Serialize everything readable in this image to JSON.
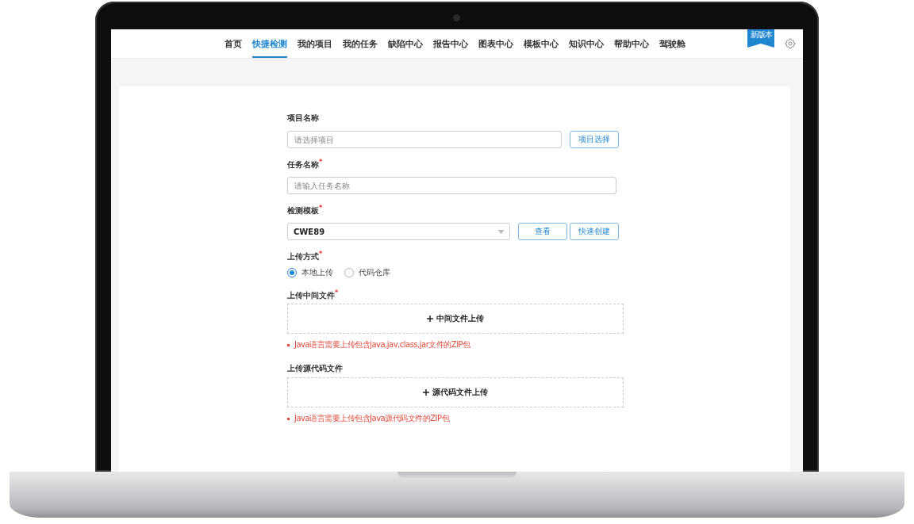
{
  "nav": {
    "items": [
      {
        "label": "首页",
        "selected": false
      },
      {
        "label": "快捷检测",
        "selected": true
      },
      {
        "label": "我的项目",
        "selected": false
      },
      {
        "label": "我的任务",
        "selected": false
      },
      {
        "label": "缺陷中心",
        "selected": false
      },
      {
        "label": "报告中心",
        "selected": false
      },
      {
        "label": "图表中心",
        "selected": false
      },
      {
        "label": "模板中心",
        "selected": false
      },
      {
        "label": "知识中心",
        "selected": false
      },
      {
        "label": "帮助中心",
        "selected": false
      },
      {
        "label": "驾驶舱",
        "selected": false
      }
    ],
    "badge": "新版本"
  },
  "form": {
    "project": {
      "label": "项目名称",
      "placeholder": "请选择项目",
      "button": "项目选择"
    },
    "task": {
      "label": "任务名称$^{*}$",
      "placeholder": "请输入任务名称"
    },
    "template": {
      "label": "检测模板$^{*}$",
      "value": "CWE89",
      "buttons": [
        "查看",
        "快速创建"
      ]
    },
    "upload_method": {
      "label": "上传方式$^{*}$",
      "options": [
        {
          "label": "本地上传",
          "selected": true
        },
        {
          "label": "代码仓库",
          "selected": false
        }
      ]
    },
    "uploads": [
      {
        "label": "上传中间文件$^{*}$",
        "button": "中间文件上传",
        "hint": "Java语言需要上传包含java,jav,class,jar文件的ZIP包"
      },
      {
        "label": "上传源代码文件",
        "button": "源代码文件上传",
        "hint": "Java语言需要上传包含Java源代码文件的ZIP包"
      }
    ]
  }
}
